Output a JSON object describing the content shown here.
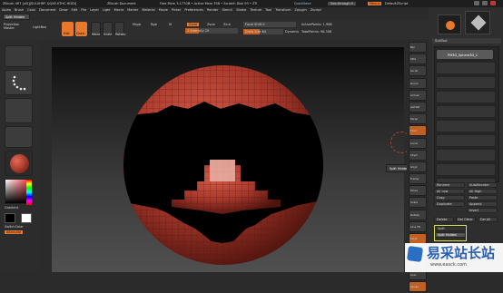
{
  "titlebar": {
    "app": "ZBrush 4R7 [xiS][SUI-XHRF-QQXE-KTHC-HDDI]",
    "doc": "ZBrush Document",
    "mem": "Free Mem 3.177GB • Active Mem 358 • Scratch Disk 93 • ZTi",
    "quicksave": "QuickSave",
    "seethrough": "See-through  0",
    "menus": "Menus",
    "script": "DefaultZScript"
  },
  "menubar": [
    "Alpha",
    "Brush",
    "Color",
    "Document",
    "Draw",
    "Edit",
    "File",
    "Layer",
    "Light",
    "Macro",
    "Marker",
    "Material",
    "Movie",
    "Picker",
    "Preferences",
    "Render",
    "Stencil",
    "Stroke",
    "Texture",
    "Tool",
    "Transform",
    "Zplugin",
    "Zscript"
  ],
  "tooltip_top": "Split Hidden",
  "shelf": {
    "projection": "Projection Master",
    "lightbox": "LightBox",
    "edit": "Edit",
    "draw": "Draw",
    "move": "Move",
    "scale": "Scale",
    "rotate": "Rotate",
    "mrgb": "Mrgb",
    "rgb": "Rgb",
    "m": "M",
    "zadd": "Zadd",
    "zsub": "Zsub",
    "zcut": "Zcut",
    "focal": "Focal Shift 0",
    "draw_size": "Draw Size 64",
    "z_intensity": "Z Intensity 25",
    "dynamic": "Dynamic",
    "active_points": "ActivePoints: 1,986",
    "total_points": "TotalPoints: 98,306"
  },
  "left": {
    "gradient": "Gradient",
    "switchcolor": "SwitchColor",
    "alternate": "Alternate"
  },
  "right_tools": [
    "Bpr",
    "SPix",
    "Scroll",
    "Zoom",
    "Actual",
    "AAHalf",
    "Persp",
    "Floor",
    "Local",
    "LSym",
    "Gxyz",
    "Frame",
    "Move",
    "Scale",
    "Rotate",
    "Line Fill",
    "PolyF",
    "Transp",
    "Ghost",
    "Solo",
    "Xpose"
  ],
  "tooltip_canvas": "Split Hidden",
  "subtool_panel": {
    "title": "SubTool",
    "rows": [
      "PM3D_Sphere3D_1"
    ]
  },
  "list_panel": {
    "rename": "Rename",
    "autoreorder": "AutoReorder",
    "all_low": "All Low",
    "all_high": "All High",
    "copy": "Copy",
    "paste": "Paste",
    "duplicate": "Duplicate",
    "append": "Append",
    "insert": "Insert",
    "delete": "Delete",
    "del_other": "Del Other",
    "del_all": "Del All",
    "split": "Split",
    "split_hidden": "Split Hidden",
    "groups_split": "Groups Split"
  },
  "watermark": {
    "brand": "易采站长站",
    "url": "www.easck.com"
  },
  "colors": {
    "accent": "#e8782b",
    "sphere": "#b8473a",
    "highlight": "#d8e04a"
  }
}
